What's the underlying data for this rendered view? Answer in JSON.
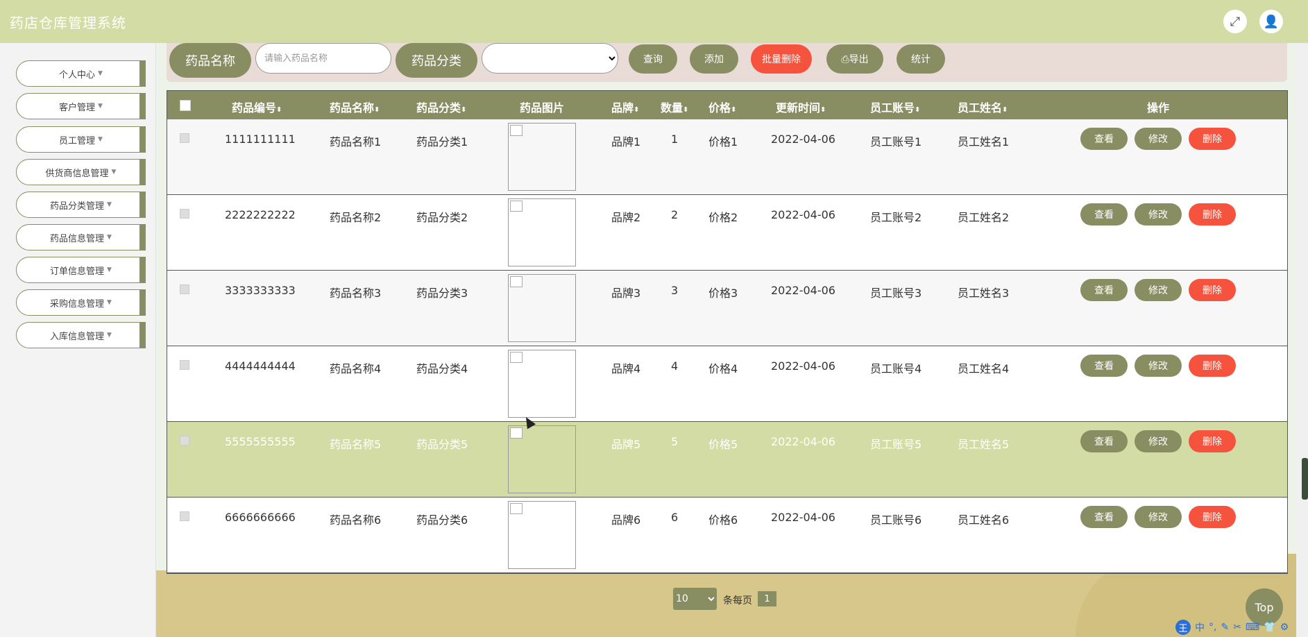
{
  "app": {
    "title": "药店仓库管理系统"
  },
  "header_icons": [
    "fullscreen-icon",
    "user-icon"
  ],
  "sidebar": {
    "items": [
      {
        "label": "个人中心"
      },
      {
        "label": "客户管理"
      },
      {
        "label": "员工管理"
      },
      {
        "label": "供货商信息管理"
      },
      {
        "label": "药品分类管理"
      },
      {
        "label": "药品信息管理"
      },
      {
        "label": "订单信息管理"
      },
      {
        "label": "采购信息管理"
      },
      {
        "label": "入库信息管理"
      }
    ]
  },
  "search": {
    "name_label": "药品名称",
    "name_placeholder": "请输入药品名称",
    "name_value": "",
    "category_label": "药品分类",
    "category_value": "",
    "query_btn": "查询",
    "add_btn": "添加",
    "batch_delete_btn": "批量删除",
    "export_btn": "导出",
    "stats_btn": "统计"
  },
  "table": {
    "columns": [
      "药品编号",
      "药品名称",
      "药品分类",
      "药品图片",
      "品牌",
      "数量",
      "价格",
      "更新时间",
      "员工账号",
      "员工姓名",
      "操作"
    ],
    "rows": [
      {
        "id": "1111111111",
        "name": "药品名称1",
        "category": "药品分类1",
        "brand": "品牌1",
        "qty": "1",
        "price": "价格1",
        "updated": "2022-04-06",
        "emp_account": "员工账号1",
        "emp_name": "员工姓名1"
      },
      {
        "id": "2222222222",
        "name": "药品名称2",
        "category": "药品分类2",
        "brand": "品牌2",
        "qty": "2",
        "price": "价格2",
        "updated": "2022-04-06",
        "emp_account": "员工账号2",
        "emp_name": "员工姓名2"
      },
      {
        "id": "3333333333",
        "name": "药品名称3",
        "category": "药品分类3",
        "brand": "品牌3",
        "qty": "3",
        "price": "价格3",
        "updated": "2022-04-06",
        "emp_account": "员工账号3",
        "emp_name": "员工姓名3"
      },
      {
        "id": "4444444444",
        "name": "药品名称4",
        "category": "药品分类4",
        "brand": "品牌4",
        "qty": "4",
        "price": "价格4",
        "updated": "2022-04-06",
        "emp_account": "员工账号4",
        "emp_name": "员工姓名4"
      },
      {
        "id": "5555555555",
        "name": "药品名称5",
        "category": "药品分类5",
        "brand": "品牌5",
        "qty": "5",
        "price": "价格5",
        "updated": "2022-04-06",
        "emp_account": "员工账号5",
        "emp_name": "员工姓名5"
      },
      {
        "id": "6666666666",
        "name": "药品名称6",
        "category": "药品分类6",
        "brand": "品牌6",
        "qty": "6",
        "price": "价格6",
        "updated": "2022-04-06",
        "emp_account": "员工账号6",
        "emp_name": "员工姓名6"
      }
    ],
    "actions": {
      "view": "查看",
      "edit": "修改",
      "delete": "删除"
    }
  },
  "pagination": {
    "page_size": "10",
    "per_page_text": "条每页",
    "current_page": "1"
  },
  "top_button": "Top",
  "colors": {
    "header": "#d3dca4",
    "accent": "#888d62",
    "danger": "#f5533d",
    "search_bg": "#e9dcd6"
  }
}
